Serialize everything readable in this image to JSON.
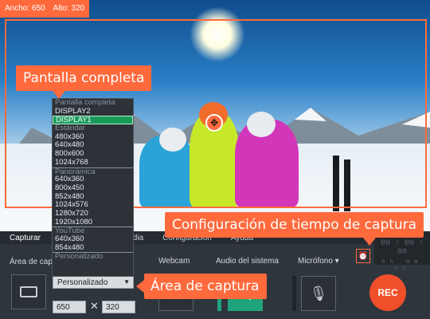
{
  "capture_size": {
    "ancho_label": "Ancho: 650",
    "alto_label": "Alto: 320"
  },
  "callouts": {
    "full_screen": "Pantalla completa",
    "time_config": "Configuración de tiempo de captura",
    "capture_area": "Área de captura"
  },
  "tabs": [
    "Capturar",
    "Media",
    "Configuración",
    "Ayuda"
  ],
  "timer": {
    "value": "00 : 00 : 00",
    "units": "hh mm ss"
  },
  "panel": {
    "area_label": "Área de cap",
    "webcam_label": "Webcam",
    "system_audio_label": "Audio del sistema",
    "mic_label": "Micrófono ▾",
    "select_value": "Personalizado",
    "width_value": "650",
    "height_value": "320",
    "times_symbol": "✕",
    "rec_label": "REC",
    "system_audio_level": 0.75
  },
  "dropdown": [
    {
      "text": "Pantalla completa",
      "kind": "head"
    },
    {
      "text": "DISPLAY2",
      "kind": "item"
    },
    {
      "text": "DISPLAY1",
      "kind": "selected"
    },
    {
      "text": "Estándar",
      "kind": "head"
    },
    {
      "text": "480x360",
      "kind": "item"
    },
    {
      "text": "640x480",
      "kind": "item"
    },
    {
      "text": "800x600",
      "kind": "item"
    },
    {
      "text": "1024x768",
      "kind": "item"
    },
    {
      "text": "Panorámica",
      "kind": "head-sep"
    },
    {
      "text": "640x360",
      "kind": "item"
    },
    {
      "text": "800x450",
      "kind": "item"
    },
    {
      "text": "852x480",
      "kind": "item"
    },
    {
      "text": "1024x576",
      "kind": "item"
    },
    {
      "text": "1280x720",
      "kind": "item"
    },
    {
      "text": "1920x1080",
      "kind": "item"
    },
    {
      "text": "YouTube",
      "kind": "head-sep"
    },
    {
      "text": "640x360",
      "kind": "item"
    },
    {
      "text": "854x480",
      "kind": "item"
    },
    {
      "text": "Personalizado",
      "kind": "head-sep"
    }
  ],
  "icons": {
    "center_handle": "move-icon",
    "capture_area": "crop-area-icon",
    "webcam": "webcam-off-icon",
    "system_audio": "speaker-icon",
    "mic": "mic-off-icon",
    "alarm": "alarm-clock-icon"
  }
}
